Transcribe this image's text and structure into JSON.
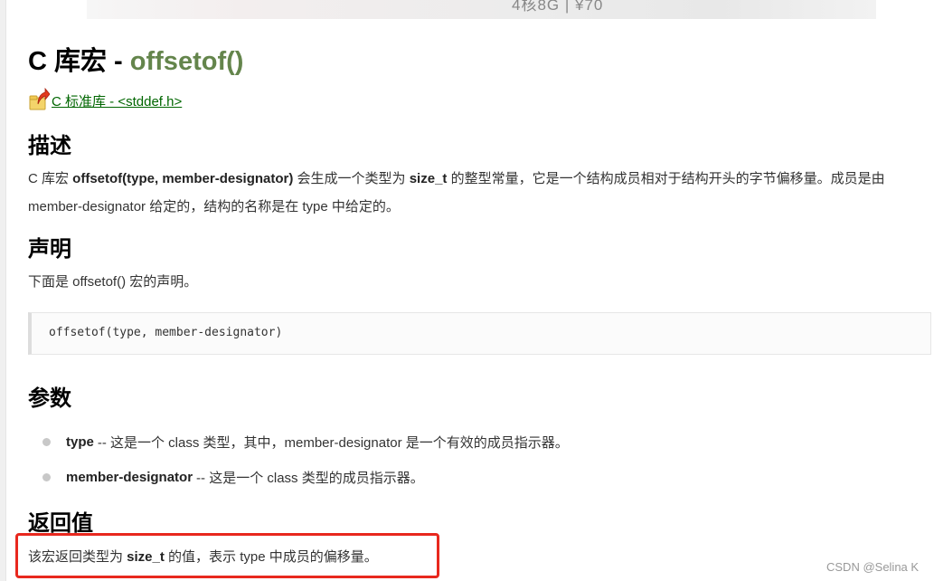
{
  "banner": {
    "text": "4核8G | ¥70"
  },
  "title": {
    "main": "C 库宏 - ",
    "accent": "offsetof()"
  },
  "back_link": {
    "label": " C 标准库 - <stddef.h>"
  },
  "sections": {
    "description": {
      "heading": "描述",
      "line1_pre": "C 库宏 ",
      "line1_bold1": "offsetof(type, member-designator)",
      "line1_mid": " 会生成一个类型为 ",
      "line1_bold2": "size_t",
      "line1_post": " 的整型常量，它是一个结构成员相对于结构开头的字节偏移量。成员是由",
      "line2": "member-designator 给定的，结构的名称是在 type 中给定的。"
    },
    "declaration": {
      "heading": "声明",
      "intro": "下面是 offsetof() 宏的声明。",
      "code": "offsetof(type, member-designator)"
    },
    "parameters": {
      "heading": "参数",
      "items": [
        {
          "name": "type",
          "desc": "-- 这是一个 class 类型，其中，member-designator 是一个有效的成员指示器。"
        },
        {
          "name": "member-designator",
          "desc": "-- 这是一个 class 类型的成员指示器。"
        }
      ]
    },
    "return_value": {
      "heading": "返回值",
      "pre": "该宏返回类型为 ",
      "bold": "size_t",
      "post": " 的值，表示 type 中成员的偏移量。"
    }
  },
  "watermark": "CSDN @Selina K",
  "colors": {
    "accent_green": "#64854c",
    "link_green": "#006600",
    "highlight_red": "#e8281e"
  }
}
